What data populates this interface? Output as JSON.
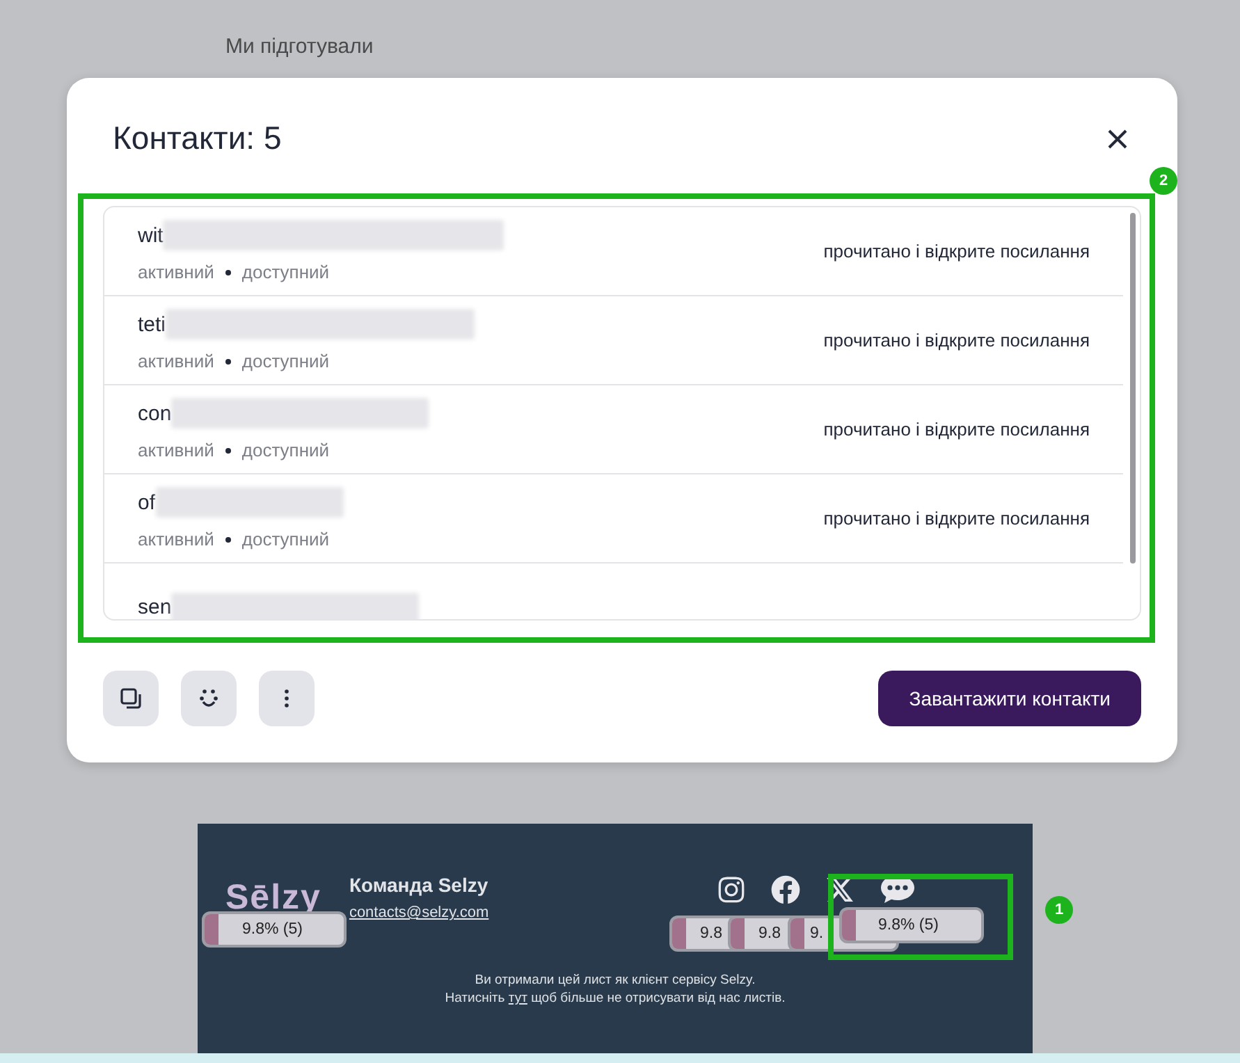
{
  "background": {
    "intro": "Ми підготували"
  },
  "modal": {
    "title": "Контакти: 5",
    "contacts": [
      {
        "email": "wit",
        "status": "активний",
        "availability": "доступний",
        "activity": "прочитано і відкрите посилання"
      },
      {
        "email": "teti",
        "status": "активний",
        "availability": "доступний",
        "activity": "прочитано і відкрите посилання"
      },
      {
        "email": "con",
        "status": "активний",
        "availability": "доступний",
        "activity": "прочитано і відкрите посилання"
      },
      {
        "email": "of",
        "status": "активний",
        "availability": "доступний",
        "activity": "прочитано і відкрите посилання"
      },
      {
        "email": "sen"
      }
    ],
    "download_button": "Завантажити контакти"
  },
  "footer": {
    "logo": "Sēlzy",
    "team": "Команда Selzy",
    "email": "contacts@selzy.com",
    "notice": "Ви отримали цей лист як клієнт сервісу Selzy.",
    "unsubscribe": {
      "before": "Натисніть",
      "link": "тут",
      "after": "щоб більше не отрисувати від нас листів."
    }
  },
  "click_stats": [
    {
      "text": "9.8% (5)"
    },
    {
      "text": "9.8"
    },
    {
      "text": "9.8"
    },
    {
      "text": "9."
    },
    {
      "text": "9.8% (5)"
    }
  ],
  "annotations": [
    {
      "number": "2"
    },
    {
      "number": "1"
    }
  ]
}
